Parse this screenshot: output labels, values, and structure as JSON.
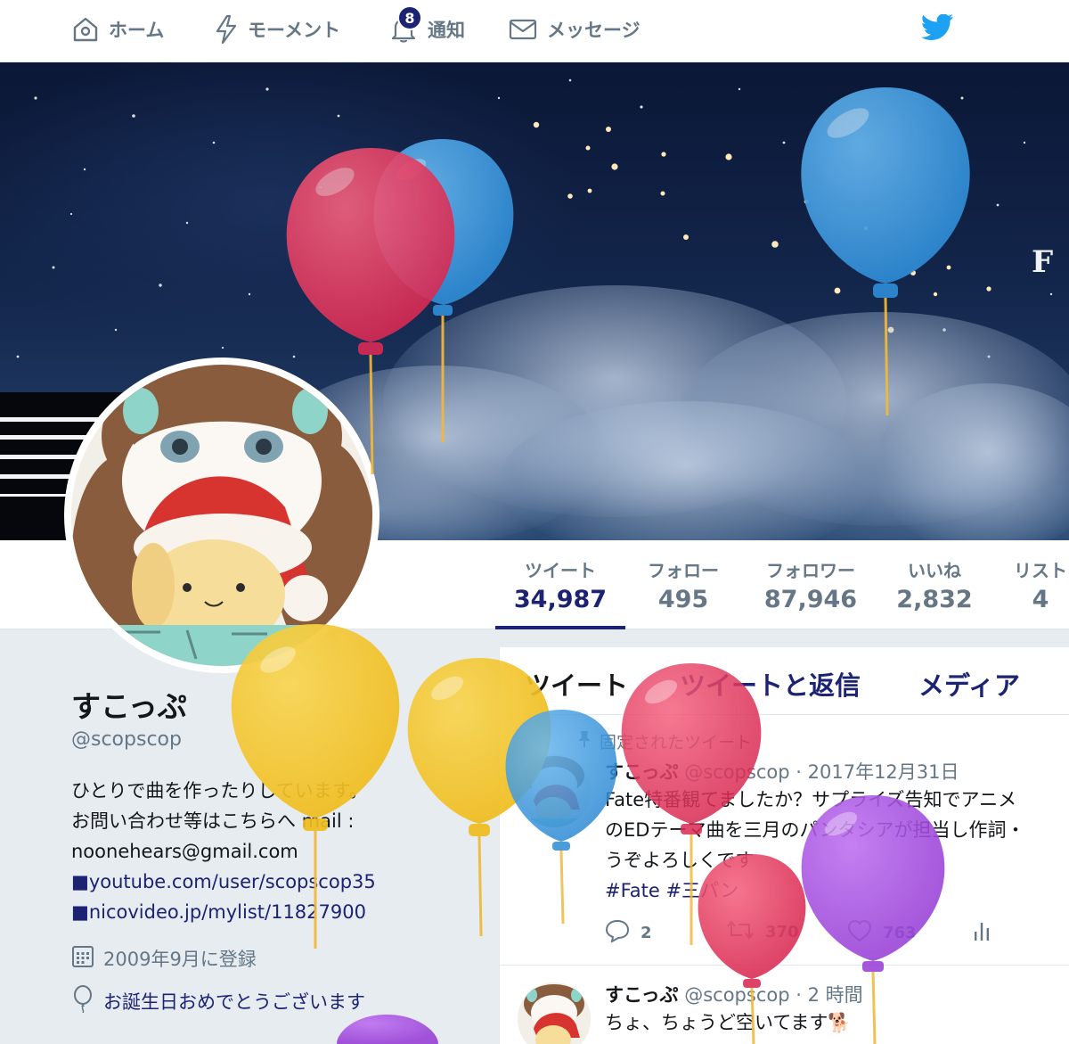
{
  "nav": {
    "home": "ホーム",
    "moments": "モーメント",
    "notifications": "通知",
    "notifications_badge": "8",
    "messages": "メッセージ"
  },
  "banner": {
    "letter": "F"
  },
  "stats": [
    {
      "label": "ツイート",
      "value": "34,987"
    },
    {
      "label": "フォロー",
      "value": "495"
    },
    {
      "label": "フォロワー",
      "value": "87,946"
    },
    {
      "label": "いいね",
      "value": "2,832"
    },
    {
      "label": "リスト",
      "value": "4"
    }
  ],
  "profile": {
    "name": "すこっぷ",
    "handle": "@scopscop",
    "bio_line1": "ひとりで曲を作ったりしています。",
    "bio_line2": "お問い合わせ等はこちらへ mail :",
    "bio_line3": "noonehears@gmail.com",
    "link1": "■youtube.com/user/scopscop35",
    "link2": "■nicovideo.jp/mylist/11827900",
    "joined": "2009年9月に登録",
    "birthday": "お誕生日おめでとうございます"
  },
  "timeline": {
    "tabs": [
      "ツイート",
      "ツイートと返信",
      "メディア"
    ],
    "pinned_label": "固定されたツイート",
    "tweet1": {
      "name": "すこっぷ",
      "handle": "@scopscop",
      "sep": "·",
      "date": "2017年12月31日",
      "line1": "Fate特番観てましたか？サプライズ告知でアニメ",
      "line2": "のEDテーマ曲を三月のパンタシアが担当し作詞・",
      "line3": "うぞよろしくです",
      "tags": "#Fate #三パン",
      "replies": "2",
      "retweets": "370",
      "likes": "763"
    },
    "tweet2": {
      "name": "すこっぷ",
      "handle": "@scopscop",
      "sep": "·",
      "time": "2 時間",
      "line1": "ちょ、ちょうど空いてます🐕"
    }
  },
  "colors": {
    "accent": "#1c2373",
    "twitter_blue": "#1da1f2",
    "balloon_red": "#e8395f",
    "balloon_blue": "#3c9be0",
    "balloon_yellow": "#f6c730",
    "balloon_purple": "#a64fdc"
  }
}
